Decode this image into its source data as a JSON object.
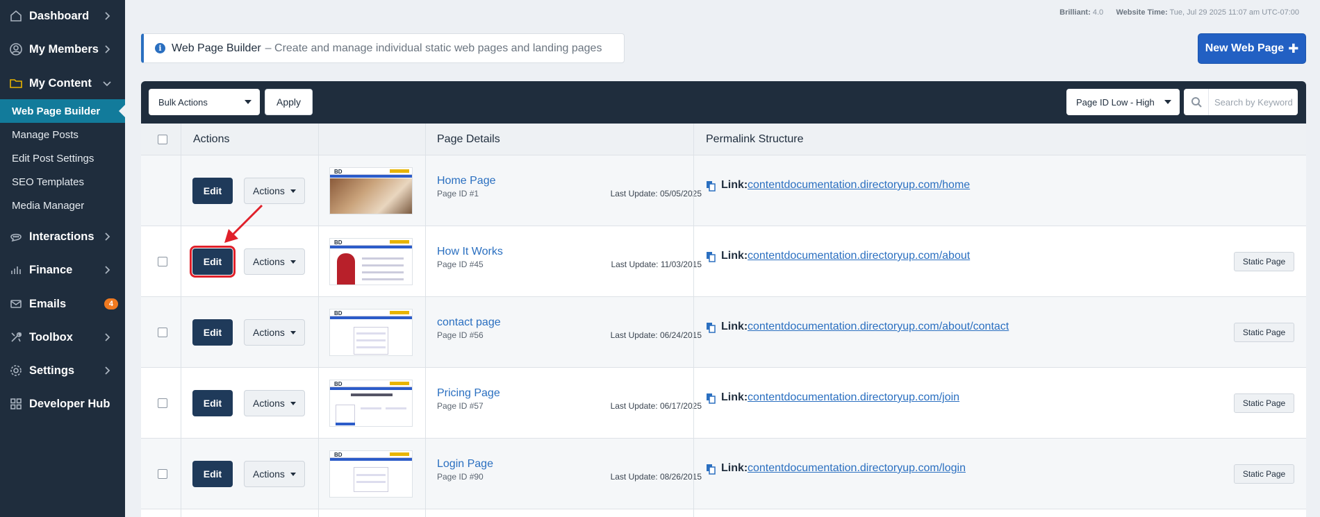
{
  "sidebar": {
    "items": [
      {
        "label": "Dashboard",
        "icon": "home-icon"
      },
      {
        "label": "My Members",
        "icon": "user-icon"
      },
      {
        "label": "My Content",
        "icon": "folder-icon"
      },
      {
        "label": "Interactions",
        "icon": "chat-icon"
      },
      {
        "label": "Finance",
        "icon": "bar-chart-icon"
      },
      {
        "label": "Emails",
        "icon": "mail-icon",
        "badge": "4"
      },
      {
        "label": "Toolbox",
        "icon": "tools-icon"
      },
      {
        "label": "Settings",
        "icon": "gear-icon"
      },
      {
        "label": "Developer Hub",
        "icon": "grid-icon"
      }
    ],
    "sub_items": [
      "Web Page Builder",
      "Manage Posts",
      "Edit Post Settings",
      "SEO Templates",
      "Media Manager"
    ]
  },
  "meta": {
    "brilliant_label": "Brilliant:",
    "brilliant_value": "4.0",
    "time_label": "Website Time:",
    "time_value": "Tue, Jul 29 2025 11:07 am UTC-07:00"
  },
  "info": {
    "title": "Web Page Builder",
    "description": "– Create and manage individual static web pages and landing pages"
  },
  "new_button": {
    "label": "New Web Page"
  },
  "toolbar": {
    "bulk_actions": "Bulk Actions",
    "apply": "Apply",
    "sort": "Page ID Low - High",
    "search_placeholder": "Search by Keyword"
  },
  "table": {
    "headers": {
      "actions": "Actions",
      "details": "Page Details",
      "permalink": "Permalink Structure"
    },
    "edit_label": "Edit",
    "actions_label": "Actions",
    "link_label": "Link:",
    "static_label": "Static Page",
    "rows": [
      {
        "name": "Home Page",
        "id": "Page ID #1",
        "updated": "Last Update: 05/05/2025",
        "url": "contentdocumentation.directoryup.com/home",
        "static": false
      },
      {
        "name": "How It Works",
        "id": "Page ID #45",
        "updated": "Last Update: 11/03/2015",
        "url": "contentdocumentation.directoryup.com/about",
        "static": true
      },
      {
        "name": "contact page",
        "id": "Page ID #56",
        "updated": "Last Update: 06/24/2015",
        "url": "contentdocumentation.directoryup.com/about/contact",
        "static": true
      },
      {
        "name": "Pricing Page",
        "id": "Page ID #57",
        "updated": "Last Update: 06/17/2025",
        "url": "contentdocumentation.directoryup.com/join",
        "static": true
      },
      {
        "name": "Login Page",
        "id": "Page ID #90",
        "updated": "Last Update: 08/26/2015",
        "url": "contentdocumentation.directoryup.com/login",
        "static": true
      }
    ]
  },
  "colors": {
    "sidebar": "#1f2d3d",
    "active": "#127b9b",
    "primary": "#2260c3",
    "highlight": "#e0202a"
  }
}
